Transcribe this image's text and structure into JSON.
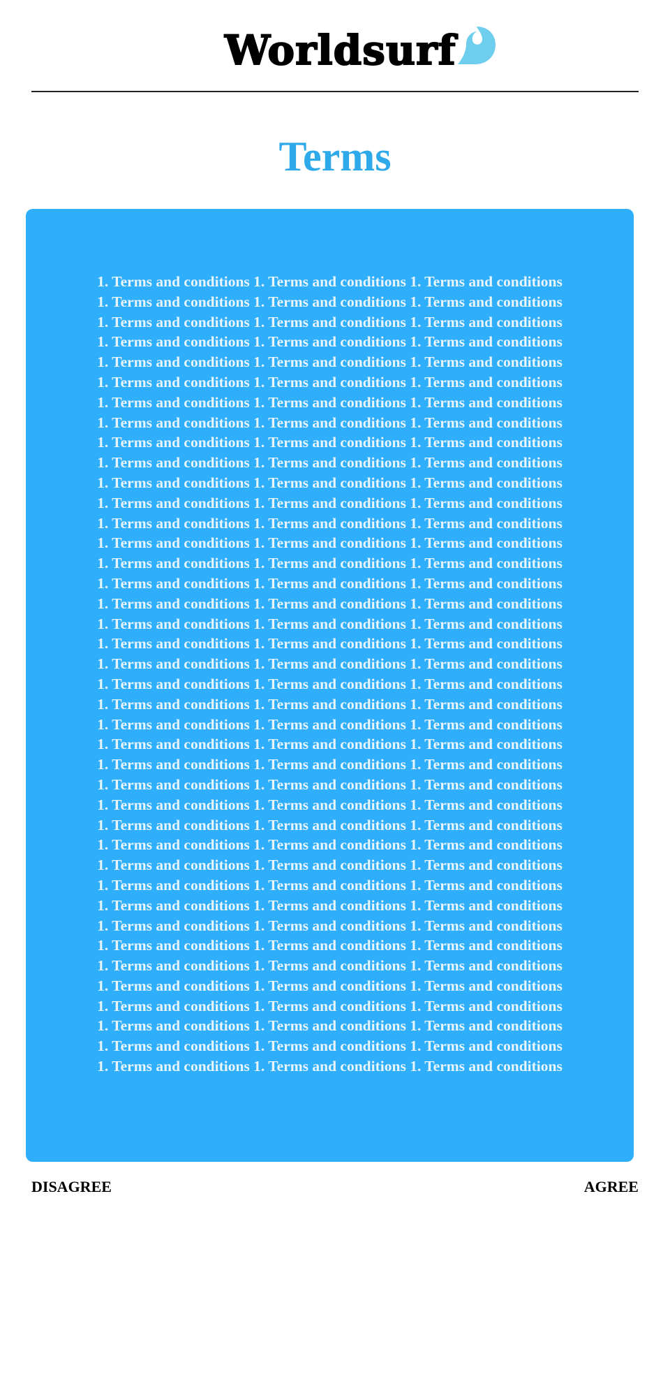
{
  "brand": {
    "name": "Worldsurf",
    "logo_icon": "wave-icon",
    "accent_color": "#6fcdee"
  },
  "page": {
    "title": "Terms",
    "title_color": "#2ea9e9"
  },
  "terms": {
    "panel_color": "#2eaefb",
    "lines": [
      "1. Terms and conditions 1. Terms and conditions 1. Terms and conditions",
      "1. Terms and conditions 1. Terms and conditions 1. Terms and conditions",
      "1. Terms and conditions 1. Terms and conditions 1. Terms and conditions",
      "1. Terms and conditions 1. Terms and conditions 1. Terms and conditions",
      "1. Terms and conditions 1. Terms and conditions 1. Terms and conditions",
      "1. Terms and conditions 1. Terms and conditions 1. Terms and conditions",
      "1. Terms and conditions 1. Terms and conditions 1. Terms and conditions",
      "1. Terms and conditions 1. Terms and conditions 1. Terms and conditions",
      "1. Terms and conditions 1. Terms and conditions 1. Terms and conditions",
      "1. Terms and conditions 1. Terms and conditions 1. Terms and conditions",
      "1. Terms and conditions 1. Terms and conditions 1. Terms and conditions",
      "1. Terms and conditions 1. Terms and conditions 1. Terms and conditions",
      "1. Terms and conditions 1. Terms and conditions 1. Terms and conditions",
      "1. Terms and conditions 1. Terms and conditions 1. Terms and conditions",
      "1. Terms and conditions 1. Terms and conditions 1. Terms and conditions",
      "1. Terms and conditions 1. Terms and conditions 1. Terms and conditions",
      "1. Terms and conditions 1. Terms and conditions 1. Terms and conditions",
      "1. Terms and conditions 1. Terms and conditions 1. Terms and conditions",
      "1. Terms and conditions 1. Terms and conditions 1. Terms and conditions",
      "1. Terms and conditions 1. Terms and conditions 1. Terms and conditions",
      "1. Terms and conditions 1. Terms and conditions 1. Terms and conditions",
      "1. Terms and conditions 1. Terms and conditions 1. Terms and conditions",
      "1. Terms and conditions 1. Terms and conditions 1. Terms and conditions",
      "1. Terms and conditions 1. Terms and conditions 1. Terms and conditions",
      "1. Terms and conditions 1. Terms and conditions 1. Terms and conditions",
      "1. Terms and conditions 1. Terms and conditions 1. Terms and conditions",
      "1. Terms and conditions 1. Terms and conditions 1. Terms and conditions",
      "1. Terms and conditions 1. Terms and conditions 1. Terms and conditions",
      "1. Terms and conditions 1. Terms and conditions 1. Terms and conditions",
      "1. Terms and conditions 1. Terms and conditions 1. Terms and conditions",
      "1. Terms and conditions 1. Terms and conditions 1. Terms and conditions",
      "1. Terms and conditions 1. Terms and conditions 1. Terms and conditions",
      "1. Terms and conditions 1. Terms and conditions 1. Terms and conditions",
      "1. Terms and conditions 1. Terms and conditions 1. Terms and conditions",
      "1. Terms and conditions 1. Terms and conditions 1. Terms and conditions",
      "1. Terms and conditions 1. Terms and conditions 1. Terms and conditions",
      "1. Terms and conditions 1. Terms and conditions 1. Terms and conditions",
      "1. Terms and conditions 1. Terms and conditions 1. Terms and conditions",
      "1. Terms and conditions 1. Terms and conditions 1. Terms and conditions",
      "1. Terms and conditions 1. Terms and conditions 1. Terms and conditions"
    ]
  },
  "actions": {
    "disagree_label": "DISAGREE",
    "agree_label": "AGREE"
  }
}
